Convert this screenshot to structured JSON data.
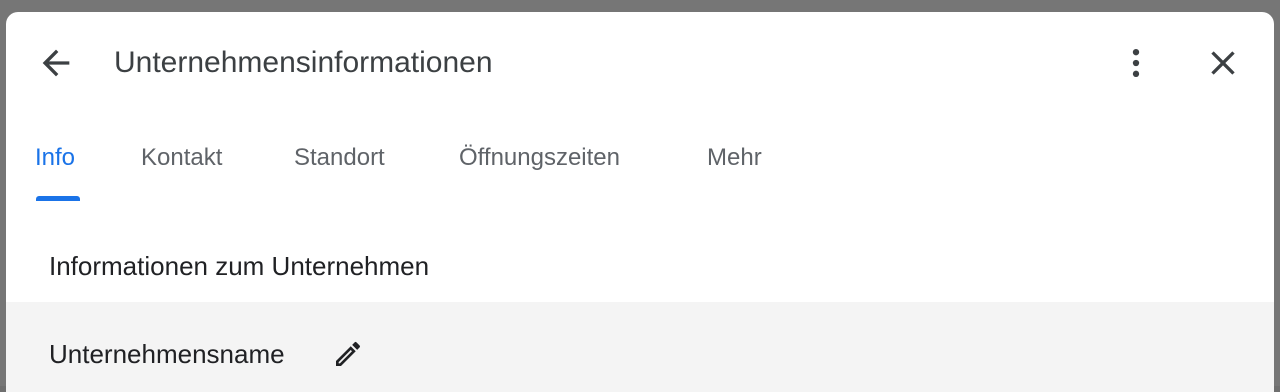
{
  "dialog": {
    "title": "Unternehmensinformationen",
    "icons": {
      "back": "arrow-back-icon",
      "more": "more-vert-icon",
      "close": "close-icon",
      "edit": "pencil-icon"
    }
  },
  "tabs": [
    {
      "label": "Info",
      "active": true
    },
    {
      "label": "Kontakt",
      "active": false
    },
    {
      "label": "Standort",
      "active": false
    },
    {
      "label": "Öffnungszeiten",
      "active": false
    },
    {
      "label": "Mehr",
      "active": false
    }
  ],
  "section": {
    "title": "Informationen zum Unternehmen"
  },
  "fields": [
    {
      "label": "Unternehmensname"
    }
  ],
  "colors": {
    "accent": "#1a73e8",
    "text_primary": "#202124",
    "text_secondary": "#5f6368",
    "row_background": "#f4f4f4"
  }
}
